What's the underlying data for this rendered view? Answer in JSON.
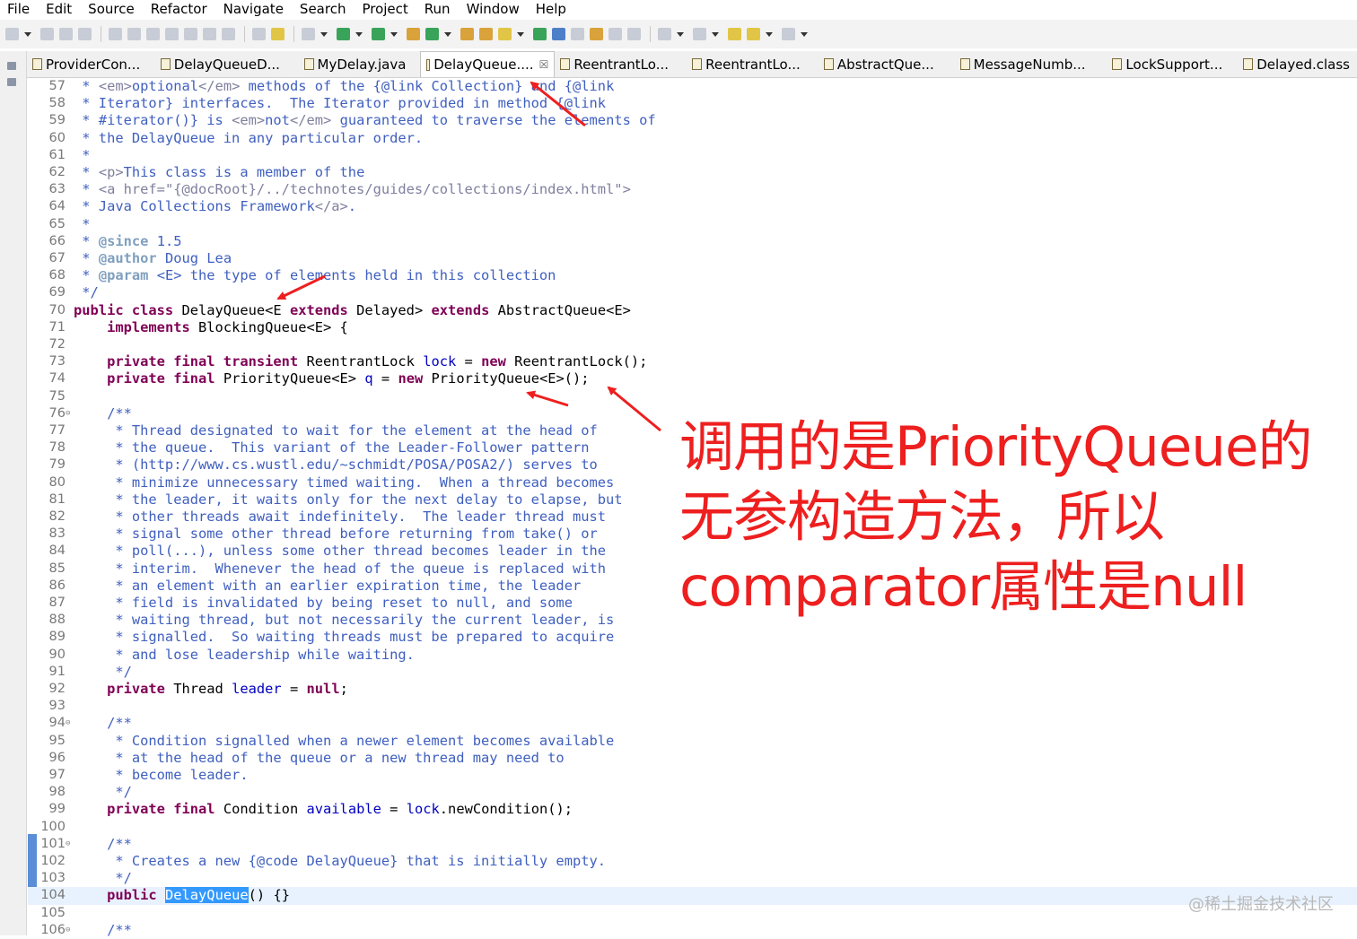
{
  "menu": [
    "File",
    "Edit",
    "Source",
    "Refactor",
    "Navigate",
    "Search",
    "Project",
    "Run",
    "Window",
    "Help"
  ],
  "tabs": [
    {
      "label": "ProviderCon...",
      "active": false
    },
    {
      "label": "DelayQueueD...",
      "active": false
    },
    {
      "label": "MyDelay.java",
      "active": false
    },
    {
      "label": "DelayQueue....",
      "active": true,
      "close": "☒"
    },
    {
      "label": "ReentrantLo...",
      "active": false
    },
    {
      "label": "ReentrantLo...",
      "active": false
    },
    {
      "label": "AbstractQue...",
      "active": false
    },
    {
      "label": "MessageNumb...",
      "active": false
    },
    {
      "label": "LockSupport...",
      "active": false
    },
    {
      "label": "Delayed.class",
      "active": false
    }
  ],
  "annotation": {
    "line1": "调用的是PriorityQueue的",
    "line2": "无参构造方法，所以",
    "line3": "comparator属性是null",
    "color": "#ee1f1f"
  },
  "watermark": "@稀土掘金技术社区",
  "code_lines": [
    {
      "n": "57",
      "segs": [
        [
          "c",
          " * "
        ],
        [
          "tag",
          "<em>"
        ],
        [
          "c",
          "optional"
        ],
        [
          "tag",
          "</em>"
        ],
        [
          "c",
          " methods of the {@link Collection} and {@link"
        ]
      ]
    },
    {
      "n": "58",
      "segs": [
        [
          "c",
          " * Iterator} interfaces.  The Iterator provided in method {@link"
        ]
      ]
    },
    {
      "n": "59",
      "segs": [
        [
          "c",
          " * #iterator()} is "
        ],
        [
          "tag",
          "<em>"
        ],
        [
          "c",
          "not"
        ],
        [
          "tag",
          "</em>"
        ],
        [
          "c",
          " guaranteed to traverse the elements of"
        ]
      ]
    },
    {
      "n": "60",
      "segs": [
        [
          "c",
          " * the DelayQueue in any particular order."
        ]
      ]
    },
    {
      "n": "61",
      "segs": [
        [
          "c",
          " *"
        ]
      ]
    },
    {
      "n": "62",
      "segs": [
        [
          "c",
          " * "
        ],
        [
          "tag",
          "<p>"
        ],
        [
          "c",
          "This class is a member of the"
        ]
      ]
    },
    {
      "n": "63",
      "segs": [
        [
          "c",
          " * "
        ],
        [
          "tag",
          "<a href=\"{@docRoot}/../technotes/guides/collections/index.html\">"
        ]
      ]
    },
    {
      "n": "64",
      "segs": [
        [
          "c",
          " * Java Collections Framework"
        ],
        [
          "tag",
          "</a>"
        ],
        [
          "c",
          "."
        ]
      ]
    },
    {
      "n": "65",
      "segs": [
        [
          "c",
          " *"
        ]
      ]
    },
    {
      "n": "66",
      "segs": [
        [
          "c",
          " * "
        ],
        [
          "jt",
          "@since"
        ],
        [
          "c",
          " 1.5"
        ]
      ]
    },
    {
      "n": "67",
      "segs": [
        [
          "c",
          " * "
        ],
        [
          "jt",
          "@author"
        ],
        [
          "c",
          " Doug Lea"
        ]
      ]
    },
    {
      "n": "68",
      "segs": [
        [
          "c",
          " * "
        ],
        [
          "jt",
          "@param"
        ],
        [
          "c",
          " <E> the type of elements held in this collection"
        ]
      ]
    },
    {
      "n": "69",
      "segs": [
        [
          "c",
          " */"
        ]
      ]
    },
    {
      "n": "70",
      "segs": [
        [
          "kw",
          "public class"
        ],
        [
          "t",
          " DelayQueue<E "
        ],
        [
          "kw",
          "extends"
        ],
        [
          "t",
          " Delayed> "
        ],
        [
          "kw",
          "extends"
        ],
        [
          "t",
          " AbstractQueue<E>"
        ]
      ]
    },
    {
      "n": "71",
      "segs": [
        [
          "t",
          "    "
        ],
        [
          "kw",
          "implements"
        ],
        [
          "t",
          " BlockingQueue<E> {"
        ]
      ]
    },
    {
      "n": "72",
      "segs": [
        [
          "t",
          ""
        ]
      ]
    },
    {
      "n": "73",
      "segs": [
        [
          "t",
          "    "
        ],
        [
          "kw",
          "private final transient"
        ],
        [
          "t",
          " ReentrantLock "
        ],
        [
          "f",
          "lock"
        ],
        [
          "t",
          " = "
        ],
        [
          "kw",
          "new"
        ],
        [
          "t",
          " ReentrantLock();"
        ]
      ]
    },
    {
      "n": "74",
      "segs": [
        [
          "t",
          "    "
        ],
        [
          "kw",
          "private final"
        ],
        [
          "t",
          " PriorityQueue<E> "
        ],
        [
          "f",
          "q"
        ],
        [
          "t",
          " = "
        ],
        [
          "kw",
          "new"
        ],
        [
          "t",
          " PriorityQueue<E>();"
        ]
      ]
    },
    {
      "n": "75",
      "segs": [
        [
          "t",
          ""
        ]
      ]
    },
    {
      "n": "76",
      "fold": true,
      "segs": [
        [
          "c",
          "    /**"
        ]
      ]
    },
    {
      "n": "77",
      "segs": [
        [
          "c",
          "     * Thread designated to wait for the element at the head of"
        ]
      ]
    },
    {
      "n": "78",
      "segs": [
        [
          "c",
          "     * the queue.  This variant of the Leader-Follower pattern"
        ]
      ]
    },
    {
      "n": "79",
      "segs": [
        [
          "c",
          "     * (http://www.cs.wustl.edu/~schmidt/POSA/POSA2/) serves to"
        ]
      ]
    },
    {
      "n": "80",
      "segs": [
        [
          "c",
          "     * minimize unnecessary timed waiting.  When a thread becomes"
        ]
      ]
    },
    {
      "n": "81",
      "segs": [
        [
          "c",
          "     * the leader, it waits only for the next delay to elapse, but"
        ]
      ]
    },
    {
      "n": "82",
      "segs": [
        [
          "c",
          "     * other threads await indefinitely.  The leader thread must"
        ]
      ]
    },
    {
      "n": "83",
      "segs": [
        [
          "c",
          "     * signal some other thread before returning from take() or"
        ]
      ]
    },
    {
      "n": "84",
      "segs": [
        [
          "c",
          "     * poll(...), unless some other thread becomes leader in the"
        ]
      ]
    },
    {
      "n": "85",
      "segs": [
        [
          "c",
          "     * interim.  Whenever the head of the queue is replaced with"
        ]
      ]
    },
    {
      "n": "86",
      "segs": [
        [
          "c",
          "     * an element with an earlier expiration time, the leader"
        ]
      ]
    },
    {
      "n": "87",
      "segs": [
        [
          "c",
          "     * field is invalidated by being reset to null, and some"
        ]
      ]
    },
    {
      "n": "88",
      "segs": [
        [
          "c",
          "     * waiting thread, but not necessarily the current leader, is"
        ]
      ]
    },
    {
      "n": "89",
      "segs": [
        [
          "c",
          "     * signalled.  So waiting threads must be prepared to acquire"
        ]
      ]
    },
    {
      "n": "90",
      "segs": [
        [
          "c",
          "     * and lose leadership while waiting."
        ]
      ]
    },
    {
      "n": "91",
      "segs": [
        [
          "c",
          "     */"
        ]
      ]
    },
    {
      "n": "92",
      "segs": [
        [
          "t",
          "    "
        ],
        [
          "kw",
          "private"
        ],
        [
          "t",
          " Thread "
        ],
        [
          "f",
          "leader"
        ],
        [
          "t",
          " = "
        ],
        [
          "kw",
          "null"
        ],
        [
          "t",
          ";"
        ]
      ]
    },
    {
      "n": "93",
      "segs": [
        [
          "t",
          ""
        ]
      ]
    },
    {
      "n": "94",
      "fold": true,
      "segs": [
        [
          "c",
          "    /**"
        ]
      ]
    },
    {
      "n": "95",
      "segs": [
        [
          "c",
          "     * Condition signalled when a newer element becomes available"
        ]
      ]
    },
    {
      "n": "96",
      "segs": [
        [
          "c",
          "     * at the head of the queue or a new thread may need to"
        ]
      ]
    },
    {
      "n": "97",
      "segs": [
        [
          "c",
          "     * become leader."
        ]
      ]
    },
    {
      "n": "98",
      "segs": [
        [
          "c",
          "     */"
        ]
      ]
    },
    {
      "n": "99",
      "segs": [
        [
          "t",
          "    "
        ],
        [
          "kw",
          "private final"
        ],
        [
          "t",
          " Condition "
        ],
        [
          "f",
          "available"
        ],
        [
          "t",
          " = "
        ],
        [
          "f",
          "lock"
        ],
        [
          "t",
          ".newCondition();"
        ]
      ]
    },
    {
      "n": "100",
      "segs": [
        [
          "t",
          ""
        ]
      ]
    },
    {
      "n": "101",
      "fold": true,
      "segs": [
        [
          "c",
          "    /**"
        ]
      ]
    },
    {
      "n": "102",
      "segs": [
        [
          "c",
          "     * Creates a new {@code DelayQueue} that is initially empty."
        ]
      ]
    },
    {
      "n": "103",
      "segs": [
        [
          "c",
          "     */"
        ]
      ]
    },
    {
      "n": "104",
      "cur": true,
      "segs": [
        [
          "t",
          "    "
        ],
        [
          "kw",
          "public"
        ],
        [
          "t",
          " "
        ],
        [
          "sel",
          "DelayQueue"
        ],
        [
          "t",
          "() {}"
        ]
      ]
    },
    {
      "n": "105",
      "segs": [
        [
          "t",
          ""
        ]
      ]
    },
    {
      "n": "106",
      "fold": true,
      "segs": [
        [
          "c",
          "    /**"
        ]
      ]
    }
  ]
}
